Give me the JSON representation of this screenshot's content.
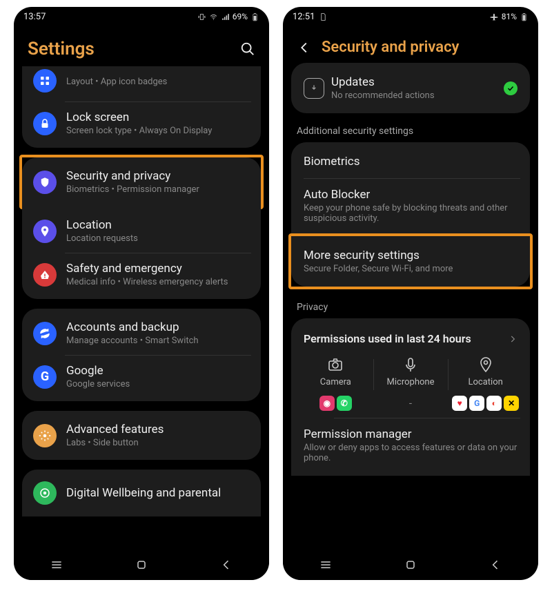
{
  "left": {
    "status": {
      "time": "13:57",
      "battery": "69%"
    },
    "title": "Settings",
    "items": [
      {
        "title": "",
        "sub": "Layout  •  App icon badges"
      },
      {
        "title": "Lock screen",
        "sub": "Screen lock type  •  Always On Display"
      },
      {
        "title": "Security and privacy",
        "sub": "Biometrics  •  Permission manager"
      },
      {
        "title": "Location",
        "sub": "Location requests"
      },
      {
        "title": "Safety and emergency",
        "sub": "Medical info  •  Wireless emergency alerts"
      },
      {
        "title": "Accounts and backup",
        "sub": "Manage accounts  •  Smart Switch"
      },
      {
        "title": "Google",
        "sub": "Google services"
      },
      {
        "title": "Advanced features",
        "sub": "Labs  •  Side button"
      },
      {
        "title": "Digital Wellbeing and parental",
        "sub": ""
      }
    ]
  },
  "right": {
    "status": {
      "time": "12:51",
      "battery": "81%"
    },
    "title": "Security and privacy",
    "updates": {
      "title": "Updates",
      "sub": "No recommended actions"
    },
    "section1": "Additional security settings",
    "biometrics": "Biometrics",
    "autoblocker": {
      "title": "Auto Blocker",
      "sub": "Keep your phone safe by blocking threats and other suspicious activity."
    },
    "more": {
      "title": "More security settings",
      "sub": "Secure Folder, Secure Wi-Fi, and more"
    },
    "section2": "Privacy",
    "permHead": "Permissions used in last 24 hours",
    "permCols": {
      "camera": "Camera",
      "mic": "Microphone",
      "location": "Location"
    },
    "permMgr": {
      "title": "Permission manager",
      "sub": "Allow or deny apps to access features or data on your phone."
    }
  }
}
